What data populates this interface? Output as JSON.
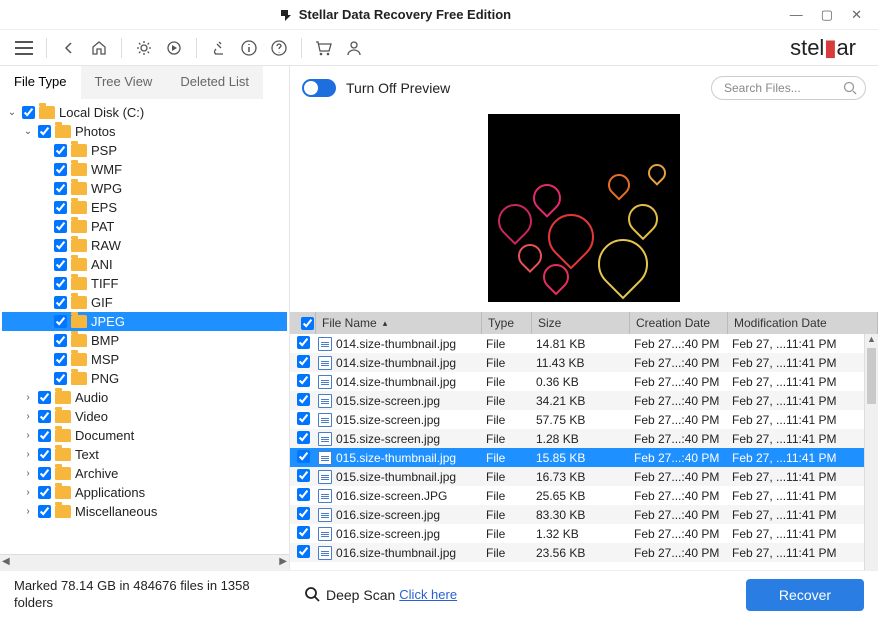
{
  "window": {
    "title": "Stellar Data Recovery Free Edition"
  },
  "brand": {
    "text_left": "stel",
    "text_right": "ar"
  },
  "tabs": {
    "file_type": "File Type",
    "tree_view": "Tree View",
    "deleted_list": "Deleted List"
  },
  "tree": {
    "root": "Local Disk (C:)",
    "photos": "Photos",
    "photo_types": [
      "PSP",
      "WMF",
      "WPG",
      "EPS",
      "PAT",
      "RAW",
      "ANI",
      "TIFF",
      "GIF",
      "JPEG",
      "BMP",
      "MSP",
      "PNG"
    ],
    "categories": [
      "Audio",
      "Video",
      "Document",
      "Text",
      "Archive",
      "Applications",
      "Miscellaneous"
    ]
  },
  "preview_toggle": "Turn Off Preview",
  "search_placeholder": "Search Files...",
  "columns": {
    "cb": "",
    "name": "File Name",
    "type": "Type",
    "size": "Size",
    "cdate": "Creation Date",
    "mdate": "Modification Date"
  },
  "files": [
    {
      "name": "014.size-thumbnail.jpg",
      "type": "File",
      "size": "14.81 KB",
      "cdate": "Feb 27...:40 PM",
      "mdate": "Feb 27, ...11:41 PM",
      "sel": false
    },
    {
      "name": "014.size-thumbnail.jpg",
      "type": "File",
      "size": "11.43 KB",
      "cdate": "Feb 27...:40 PM",
      "mdate": "Feb 27, ...11:41 PM",
      "sel": false
    },
    {
      "name": "014.size-thumbnail.jpg",
      "type": "File",
      "size": "0.36 KB",
      "cdate": "Feb 27...:40 PM",
      "mdate": "Feb 27, ...11:41 PM",
      "sel": false
    },
    {
      "name": "015.size-screen.jpg",
      "type": "File",
      "size": "34.21 KB",
      "cdate": "Feb 27...:40 PM",
      "mdate": "Feb 27, ...11:41 PM",
      "sel": false
    },
    {
      "name": "015.size-screen.jpg",
      "type": "File",
      "size": "57.75 KB",
      "cdate": "Feb 27...:40 PM",
      "mdate": "Feb 27, ...11:41 PM",
      "sel": false
    },
    {
      "name": "015.size-screen.jpg",
      "type": "File",
      "size": "1.28 KB",
      "cdate": "Feb 27...:40 PM",
      "mdate": "Feb 27, ...11:41 PM",
      "sel": false
    },
    {
      "name": "015.size-thumbnail.jpg",
      "type": "File",
      "size": "15.85 KB",
      "cdate": "Feb 27...:40 PM",
      "mdate": "Feb 27, ...11:41 PM",
      "sel": true
    },
    {
      "name": "015.size-thumbnail.jpg",
      "type": "File",
      "size": "16.73 KB",
      "cdate": "Feb 27...:40 PM",
      "mdate": "Feb 27, ...11:41 PM",
      "sel": false
    },
    {
      "name": "016.size-screen.JPG",
      "type": "File",
      "size": "25.65 KB",
      "cdate": "Feb 27...:40 PM",
      "mdate": "Feb 27, ...11:41 PM",
      "sel": false
    },
    {
      "name": "016.size-screen.jpg",
      "type": "File",
      "size": "83.30 KB",
      "cdate": "Feb 27...:40 PM",
      "mdate": "Feb 27, ...11:41 PM",
      "sel": false
    },
    {
      "name": "016.size-screen.jpg",
      "type": "File",
      "size": "1.32 KB",
      "cdate": "Feb 27...:40 PM",
      "mdate": "Feb 27, ...11:41 PM",
      "sel": false
    },
    {
      "name": "016.size-thumbnail.jpg",
      "type": "File",
      "size": "23.56 KB",
      "cdate": "Feb 27...:40 PM",
      "mdate": "Feb 27, ...11:41 PM",
      "sel": false
    }
  ],
  "footer": {
    "marked": "Marked 78.14 GB in 484676 files in 1358 folders",
    "deep_label": "Deep Scan",
    "deep_link": "Click here",
    "recover": "Recover"
  }
}
